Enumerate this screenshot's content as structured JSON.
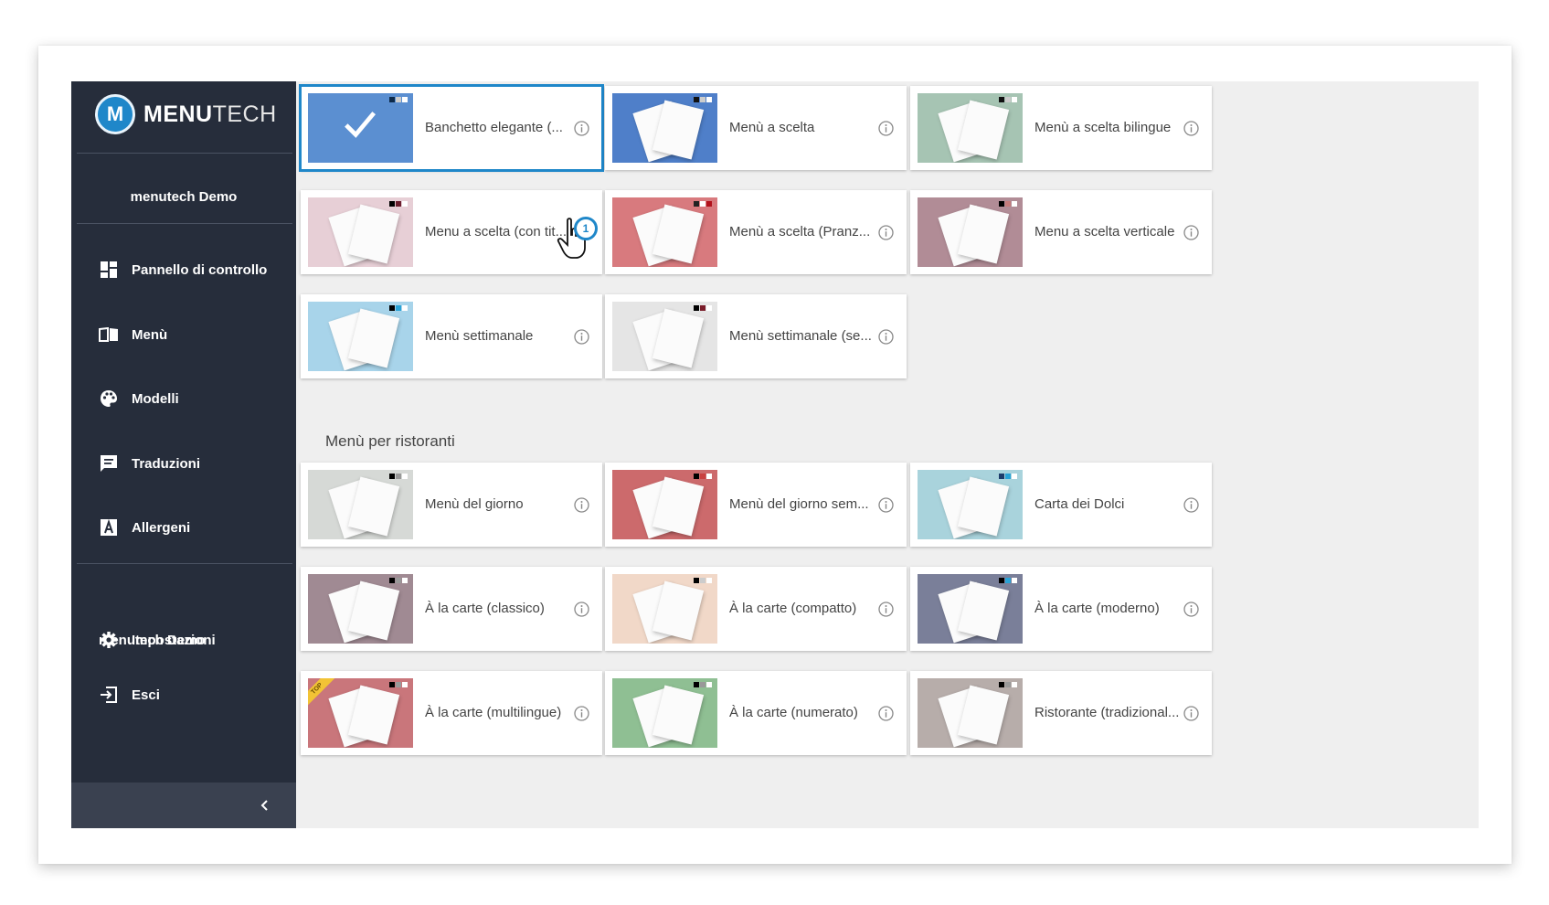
{
  "brand": {
    "name_bold": "MENU",
    "name_light": "TECH",
    "logo_letter": "M"
  },
  "sidebar": {
    "account_name": "menutech Demo",
    "items": [
      {
        "label": "Pannello di controllo",
        "icon": "dashboard-icon"
      },
      {
        "label": "Menù",
        "icon": "book-icon"
      },
      {
        "label": "Modelli",
        "icon": "palette-icon"
      },
      {
        "label": "Traduzioni",
        "icon": "translate-icon"
      },
      {
        "label": "Allergeni",
        "icon": "allergen-icon"
      }
    ],
    "org_name": "menutech Demo",
    "settings_label": "Impostazioni",
    "logout_label": "Esci"
  },
  "section_title": "Menù per ristoranti",
  "cursor_badge": "1",
  "templates_top": [
    {
      "title": "Banchetto elegante (...",
      "bg": "#5b8fd1",
      "selected": true,
      "swatch": [
        "#0d2a4a",
        "#cccccc",
        "#ffffff"
      ]
    },
    {
      "title": "Menù a scelta",
      "bg": "#4f7fc9",
      "swatch": [
        "#111111",
        "#cccccc",
        "#ffffff"
      ]
    },
    {
      "title": "Menù a scelta bilingue",
      "bg": "#a6c4b3",
      "swatch": [
        "#111111",
        "#cccccc",
        "#ffffff"
      ]
    },
    {
      "title": "Menu a scelta (con tit...",
      "bg": "#e7cfd6",
      "swatch": [
        "#000000",
        "#6b1e2e",
        "#ffffff"
      ]
    },
    {
      "title": "Menù a scelta (Pranz...",
      "bg": "#d87a7e",
      "swatch": [
        "#222222",
        "#ffffff",
        "#b1121c"
      ]
    },
    {
      "title": "Menu a scelta verticale",
      "bg": "#b18c96",
      "swatch": [
        "#000000",
        "#c47b7b",
        "#ffffff"
      ]
    },
    {
      "title": "Menù settimanale",
      "bg": "#a8d4ea",
      "swatch": [
        "#000000",
        "#2aa3d6",
        "#ffffff"
      ]
    },
    {
      "title": "Menù settimanale (se...",
      "bg": "#e5e5e5",
      "swatch": [
        "#000000",
        "#7a1c2a",
        "#ffffff"
      ]
    }
  ],
  "templates_restaurant": [
    {
      "title": "Menù del giorno",
      "bg": "#d6d9d6",
      "swatch": [
        "#000000",
        "#999999",
        "#ffffff"
      ]
    },
    {
      "title": "Menù del giorno sem...",
      "bg": "#cc6a6c",
      "swatch": [
        "#000000",
        "#c94040",
        "#ffffff"
      ]
    },
    {
      "title": "Carta dei Dolci",
      "bg": "#a9d3dc",
      "swatch": [
        "#1d3c6b",
        "#2aa3d6",
        "#ffffff"
      ]
    },
    {
      "title": "À la carte (classico)",
      "bg": "#a08a93",
      "swatch": [
        "#000000",
        "#999999",
        "#ffffff"
      ]
    },
    {
      "title": "À la carte (compatto)",
      "bg": "#f1d8c8",
      "swatch": [
        "#000000",
        "#cccccc",
        "#ffffff"
      ]
    },
    {
      "title": "À la carte (moderno)",
      "bg": "#7a7f99",
      "swatch": [
        "#000000",
        "#2aa3d6",
        "#ffffff"
      ]
    },
    {
      "title": "À la carte (multilingue)",
      "bg": "#c9767b",
      "swatch": [
        "#000000",
        "#999999",
        "#ffffff"
      ],
      "ribbon": "TOP"
    },
    {
      "title": "À la carte (numerato)",
      "bg": "#8fbf93",
      "swatch": [
        "#000000",
        "#999999",
        "#ffffff"
      ]
    },
    {
      "title": "Ristorante (tradizional...",
      "bg": "#b7adaa",
      "swatch": [
        "#000000",
        "#999999",
        "#ffffff"
      ]
    }
  ]
}
